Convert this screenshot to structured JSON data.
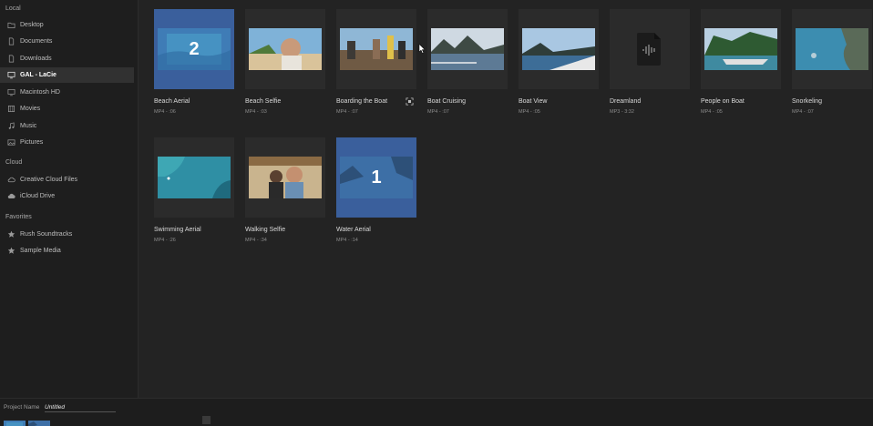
{
  "sidebar": {
    "local_label": "Local",
    "local_items": [
      {
        "label": "Desktop",
        "icon": "folder-icon"
      },
      {
        "label": "Documents",
        "icon": "document-icon"
      },
      {
        "label": "Downloads",
        "icon": "document-icon"
      },
      {
        "label": "GAL - LaCie",
        "icon": "monitor-icon",
        "selected": true
      },
      {
        "label": "Macintosh HD",
        "icon": "monitor-icon"
      },
      {
        "label": "Movies",
        "icon": "film-icon"
      },
      {
        "label": "Music",
        "icon": "music-icon"
      },
      {
        "label": "Pictures",
        "icon": "image-icon"
      }
    ],
    "cloud_label": "Cloud",
    "cloud_items": [
      {
        "label": "Creative Cloud Files",
        "icon": "cloud-icon"
      },
      {
        "label": "iCloud Drive",
        "icon": "cloud-icon"
      }
    ],
    "favorites_label": "Favorites",
    "favorite_items": [
      {
        "label": "Rush Soundtracks",
        "icon": "star-icon"
      },
      {
        "label": "Sample Media",
        "icon": "star-icon"
      }
    ]
  },
  "media": [
    {
      "name": "Beach Aerial",
      "meta": "MP4 - :06",
      "selected_order": "2"
    },
    {
      "name": "Beach Selfie",
      "meta": "MP4 - :03"
    },
    {
      "name": "Boarding the Boat",
      "meta": "MP4 - :07"
    },
    {
      "name": "Boat Cruising",
      "meta": "MP4 - :07"
    },
    {
      "name": "Boat View",
      "meta": "MP4 - :05"
    },
    {
      "name": "Dreamland",
      "meta": "MP3 - 3:32"
    },
    {
      "name": "People on Boat",
      "meta": "MP4 - :05"
    },
    {
      "name": "Snorkeling",
      "meta": "MP4 - :07"
    },
    {
      "name": "Swimming Aerial",
      "meta": "MP4 - :26"
    },
    {
      "name": "Walking Selfie",
      "meta": "MP4 - :34"
    },
    {
      "name": "Water Aerial",
      "meta": "MP4 - :14",
      "selected_order": "1"
    }
  ],
  "bottom": {
    "project_name_label": "Project Name",
    "project_name_value": "Untitled"
  },
  "colors": {
    "selection": "#3a5f9c",
    "background": "#232323",
    "sidebar": "#1e1e1e"
  }
}
